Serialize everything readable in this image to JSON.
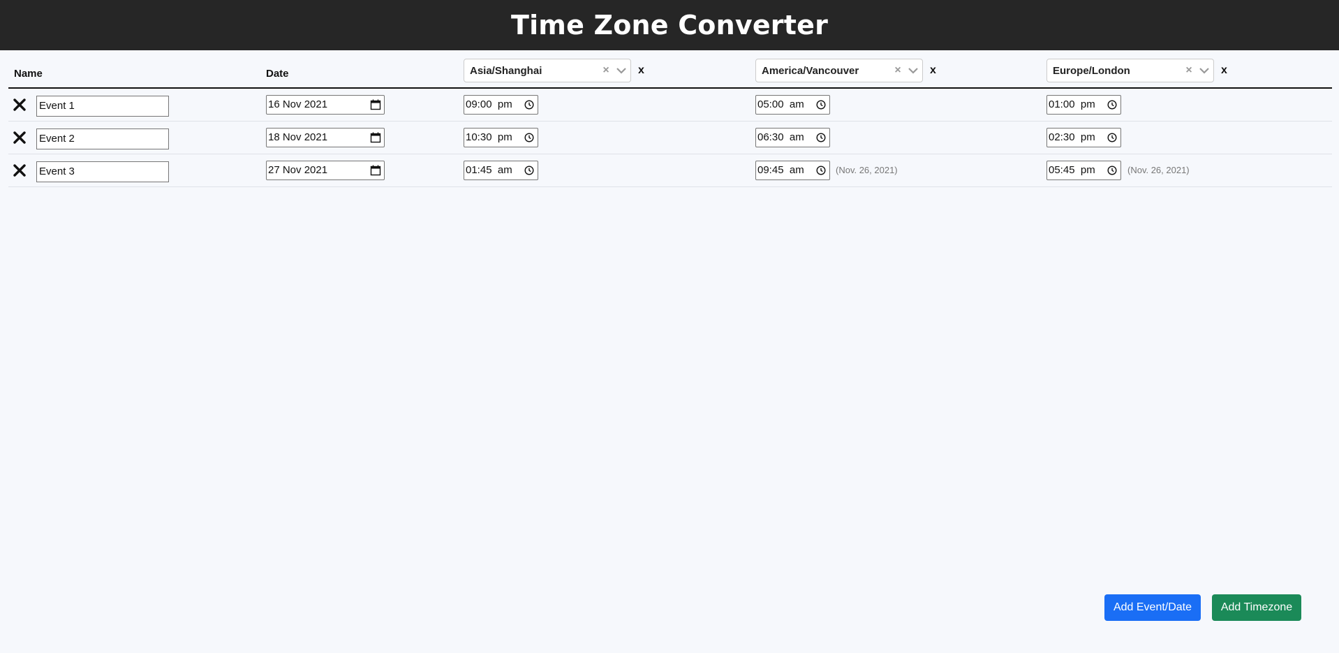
{
  "app": {
    "title": "Time Zone Converter"
  },
  "table": {
    "headers": {
      "name": "Name",
      "date": "Date"
    },
    "timezones": [
      {
        "value": "Asia/Shanghai",
        "clear": "×",
        "remove": "x"
      },
      {
        "value": "America/Vancouver",
        "clear": "×",
        "remove": "x"
      },
      {
        "value": "Europe/London",
        "clear": "×",
        "remove": "x"
      }
    ],
    "rows": [
      {
        "name": "Event 1",
        "date": "16 Nov 2021",
        "times": [
          {
            "time": "09:00",
            "ampm": "pm",
            "note": ""
          },
          {
            "time": "05:00",
            "ampm": "am",
            "note": ""
          },
          {
            "time": "01:00",
            "ampm": "pm",
            "note": ""
          }
        ]
      },
      {
        "name": "Event 2",
        "date": "18 Nov 2021",
        "times": [
          {
            "time": "10:30",
            "ampm": "pm",
            "note": ""
          },
          {
            "time": "06:30",
            "ampm": "am",
            "note": ""
          },
          {
            "time": "02:30",
            "ampm": "pm",
            "note": ""
          }
        ]
      },
      {
        "name": "Event 3",
        "date": "27 Nov 2021",
        "times": [
          {
            "time": "01:45",
            "ampm": "am",
            "note": ""
          },
          {
            "time": "09:45",
            "ampm": "am",
            "note": "(Nov. 26, 2021)"
          },
          {
            "time": "05:45",
            "ampm": "pm",
            "note": "(Nov. 26, 2021)"
          }
        ]
      }
    ]
  },
  "actions": {
    "add_event": "Add Event/Date",
    "add_timezone": "Add Timezone"
  },
  "colors": {
    "header_bg": "#262626",
    "page_bg": "#f6f8fc",
    "primary": "#1a6ef5",
    "success": "#1b8a58"
  }
}
